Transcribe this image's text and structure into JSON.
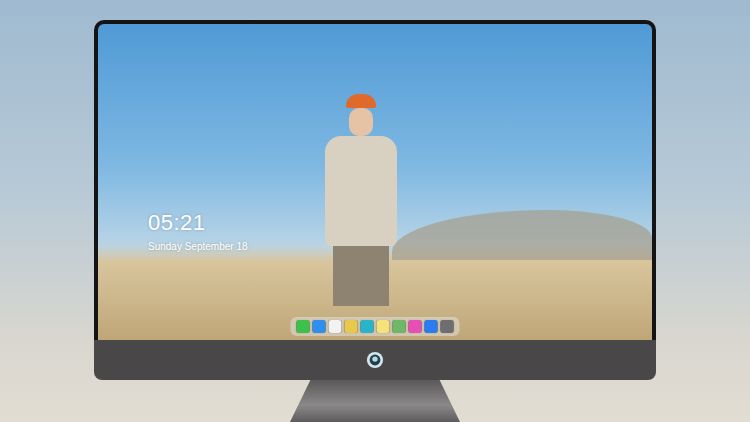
{
  "lock_screen": {
    "time": "05:21",
    "date": "Sunday September 18"
  },
  "dock": {
    "items": [
      {
        "color": "#3cc24a"
      },
      {
        "color": "#2f8ff0"
      },
      {
        "color": "#f2f2f2"
      },
      {
        "color": "#e9c94a"
      },
      {
        "color": "#29b5c9"
      },
      {
        "color": "#f5e27a"
      },
      {
        "color": "#6fb86a"
      },
      {
        "color": "#e84fb6"
      },
      {
        "color": "#2b7cf0"
      },
      {
        "color": "#6d6d72"
      }
    ]
  }
}
